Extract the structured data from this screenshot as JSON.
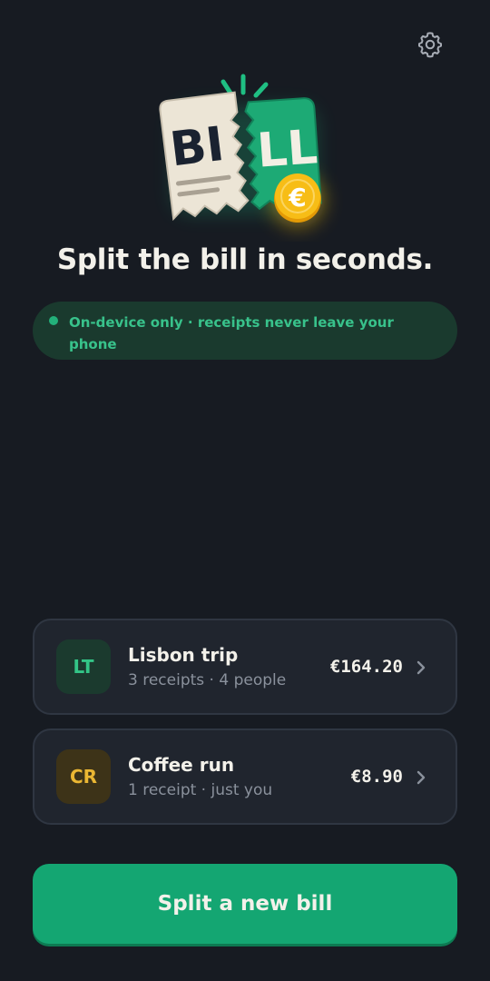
{
  "header": {
    "settings_icon": "gear-icon"
  },
  "logo": {
    "left_text": "BI",
    "right_text": "LL",
    "coin_symbol": "€"
  },
  "headline": "Split the bill in seconds.",
  "privacy": {
    "text": "On-device only · receipts never leave your phone"
  },
  "recent_bills": [
    {
      "initials": "LT",
      "title": "Lisbon trip",
      "subtitle": "3 receipts · 4 people",
      "amount": "€164.20"
    },
    {
      "initials": "CR",
      "title": "Coffee run",
      "subtitle": "1 receipt · just you",
      "amount": "€8.90"
    }
  ],
  "cta": {
    "label": "Split a new bill"
  },
  "colors": {
    "background": "#171b22",
    "accent": "#14a672",
    "card": "#20252e",
    "coin": "#f5b50f"
  }
}
